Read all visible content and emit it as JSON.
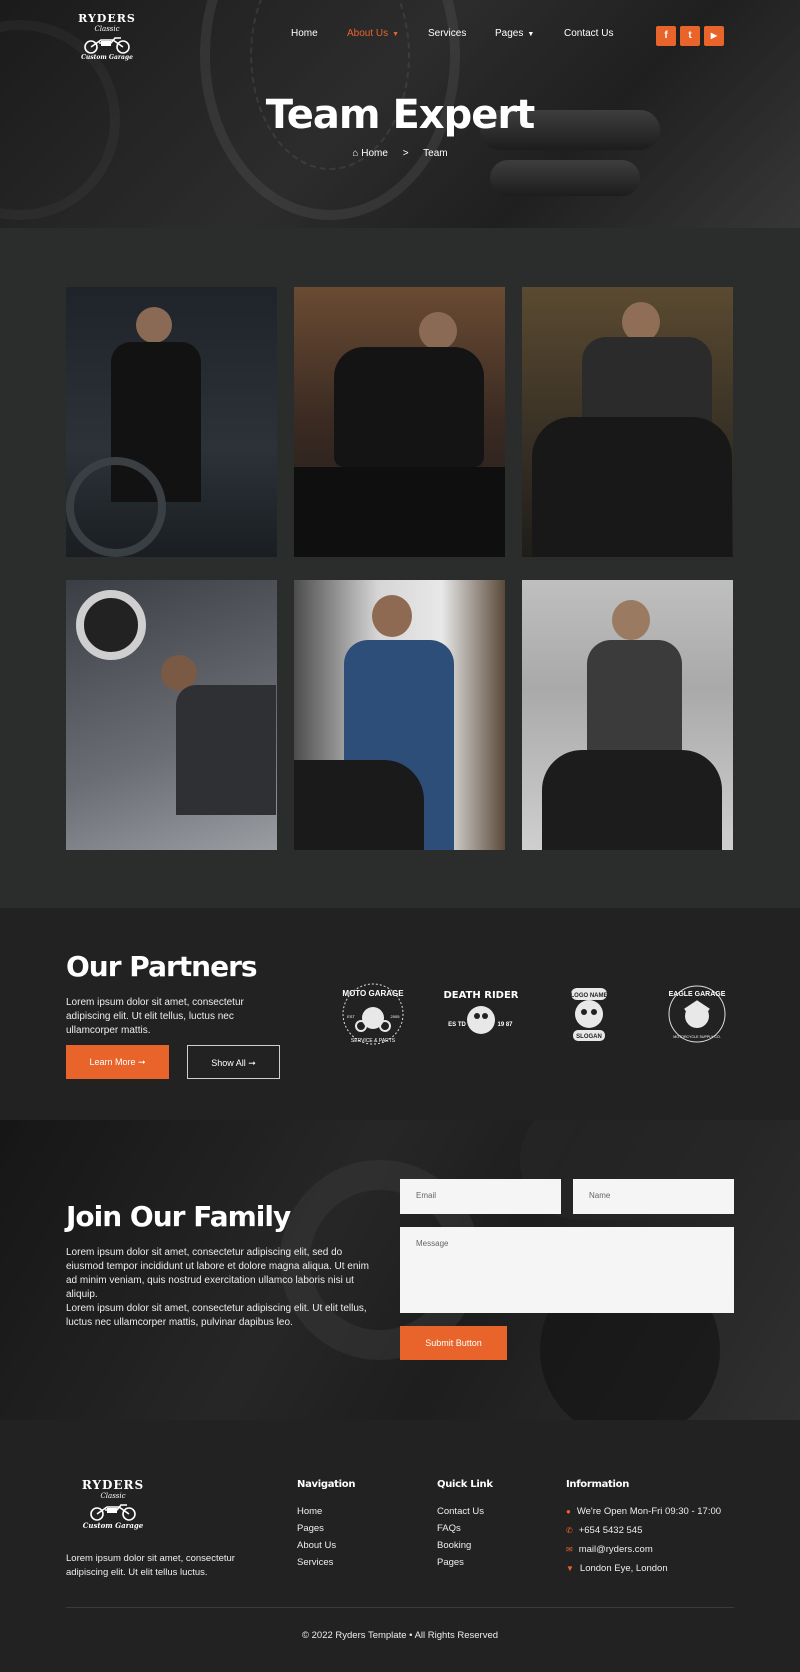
{
  "logo": {
    "brand": "RYDERS",
    "sub": "Classic",
    "tag": "Custom Garage"
  },
  "nav": {
    "items": [
      {
        "label": "Home"
      },
      {
        "label": "About Us"
      },
      {
        "label": "Services"
      },
      {
        "label": "Pages"
      },
      {
        "label": "Contact Us"
      }
    ],
    "active_color": "#e8642b"
  },
  "social": {
    "facebook": "f",
    "twitter": "t",
    "youtube": "▶"
  },
  "hero": {
    "title": "Team Expert",
    "crumb_home": "Home",
    "crumb_sep": ">",
    "crumb_current": "Team"
  },
  "team": {
    "photos": [
      "Biker in leather jacket",
      "Rider on motorcycle",
      "Mechanic with bike",
      "Mechanic working",
      "Mechanic in overalls",
      "Rider on motorcycle"
    ]
  },
  "partners": {
    "title": "Our Partners",
    "text": "Lorem ipsum dolor sit amet, consectetur adipiscing elit. Ut elit tellus, luctus nec ullamcorper mattis.",
    "learn_more": "Learn More ➞",
    "show_all": "Show All ➞",
    "badges": [
      {
        "top": "MOTO GARAGE",
        "left": "EST",
        "right": "2005",
        "bottom": "SERVICE & PARTS"
      },
      {
        "top": "DEATH RIDER",
        "left": "ES TD",
        "right": "19 87",
        "bottom": ""
      },
      {
        "top": "LOGO NAME",
        "left": "",
        "right": "",
        "bottom": "SLOGAN"
      },
      {
        "top": "EAGLE GARAGE",
        "left": "",
        "right": "",
        "bottom": "MOTORCYCLE SUPPLY CO."
      }
    ]
  },
  "join": {
    "title": "Join Our Family",
    "para1": "Lorem ipsum dolor sit amet, consectetur adipiscing elit, sed do eiusmod tempor incididunt ut labore et dolore magna aliqua. Ut enim ad minim veniam, quis nostrud exercitation ullamco laboris nisi ut aliquip.",
    "para2": "Lorem ipsum dolor sit amet, consectetur adipiscing elit. Ut elit tellus, luctus nec ullamcorper mattis, pulvinar dapibus leo.",
    "email_placeholder": "Email",
    "name_placeholder": "Name",
    "message_placeholder": "Message",
    "submit": "Submit Button"
  },
  "footer": {
    "about": "Lorem ipsum dolor sit amet, consectetur adipiscing elit. Ut elit tellus luctus.",
    "navigation_title": "Navigation",
    "navigation": [
      "Home",
      "Pages",
      "About Us",
      "Services"
    ],
    "quick_title": "Quick Link",
    "quick": [
      "Contact Us",
      "FAQs",
      "Booking",
      "Pages"
    ],
    "info_title": "Information",
    "info": {
      "hours": "We're Open Mon-Fri 09:30 - 17:00",
      "phone": "+654 5432 545",
      "email": "mail@ryders.com",
      "address": "London Eye, London"
    },
    "copyright": "© 2022 Ryders Template • All Rights Reserved"
  },
  "colors": {
    "accent": "#e8642b",
    "dark": "#222222",
    "team_bg": "#2b2d2c"
  }
}
